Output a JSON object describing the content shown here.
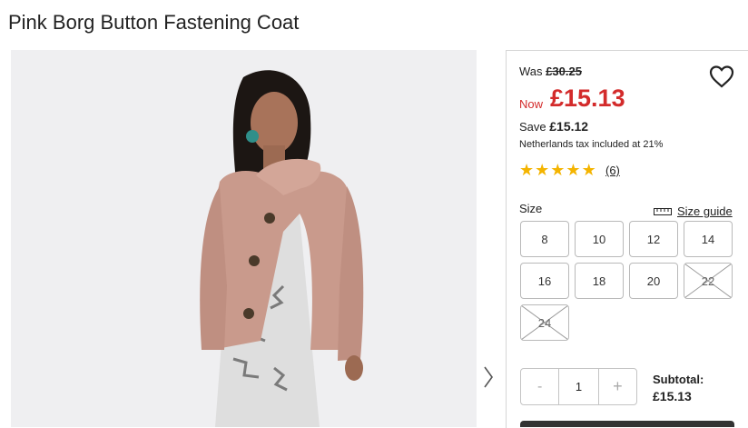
{
  "product": {
    "title": "Pink Borg Button Fastening Coat"
  },
  "price": {
    "was_label": "Was",
    "was_value": "£30.25",
    "now_label": "Now",
    "now_value": "£15.13",
    "save_label": "Save",
    "save_value": "£15.12",
    "tax_note": "Netherlands tax included at 21%"
  },
  "rating": {
    "stars": 5,
    "reviews_label": "(6)"
  },
  "size": {
    "label": "Size",
    "guide_label": "Size guide",
    "options": [
      {
        "label": "8",
        "available": true
      },
      {
        "label": "10",
        "available": true
      },
      {
        "label": "12",
        "available": true
      },
      {
        "label": "14",
        "available": true
      },
      {
        "label": "16",
        "available": true
      },
      {
        "label": "18",
        "available": true
      },
      {
        "label": "20",
        "available": true
      },
      {
        "label": "22",
        "available": false
      },
      {
        "label": "24",
        "available": false
      }
    ]
  },
  "quantity": {
    "minus": "-",
    "value": "1",
    "plus": "+"
  },
  "subtotal": {
    "label": "Subtotal:",
    "value": "£15.13"
  },
  "colors": {
    "sale": "#d32b2b",
    "star": "#f4b400",
    "coat": "#c99a8c"
  },
  "icons": {
    "wishlist": "heart-icon",
    "gallery_next": "chevron-right-icon",
    "size_guide": "ruler-icon"
  }
}
